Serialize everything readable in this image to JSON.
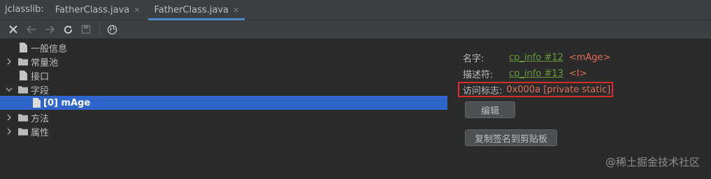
{
  "tool_window": {
    "label": "jclasslib:"
  },
  "tabs": [
    {
      "label": "FatherClass.java",
      "active": false
    },
    {
      "label": "FatherClass.java",
      "active": true
    }
  ],
  "toolbar": {
    "icons": [
      "close-icon",
      "back-arrow-icon",
      "forward-arrow-icon",
      "refresh-icon",
      "save-icon",
      "web-icon"
    ]
  },
  "tree": {
    "items": [
      {
        "label": "一般信息",
        "expandable": false,
        "expanded": false
      },
      {
        "label": "常量池",
        "expandable": true,
        "expanded": false
      },
      {
        "label": "接口",
        "expandable": false,
        "expanded": false
      },
      {
        "label": "字段",
        "expandable": true,
        "expanded": true
      },
      {
        "label": "[0] mAge",
        "expandable": false,
        "selected": true
      },
      {
        "label": "方法",
        "expandable": true,
        "expanded": false
      },
      {
        "label": "属性",
        "expandable": true,
        "expanded": false
      }
    ]
  },
  "detail": {
    "name_label": "名字:",
    "name_link": "cp_info #12",
    "name_value": "<mAge>",
    "descriptor_label": "描述符:",
    "descriptor_link": "cp_info #13",
    "descriptor_value": "<I>",
    "access_label": "访问标志:",
    "access_value": "0x000a [private static]",
    "edit_button": "编辑",
    "copy_button": "复制签名到剪贴板"
  },
  "watermark": "@稀土掘金技术社区",
  "colors": {
    "selection": "#2f65ca",
    "link": "#6a9a3a",
    "value_red": "#e06c5c",
    "highlight_box": "#d82b2b"
  }
}
